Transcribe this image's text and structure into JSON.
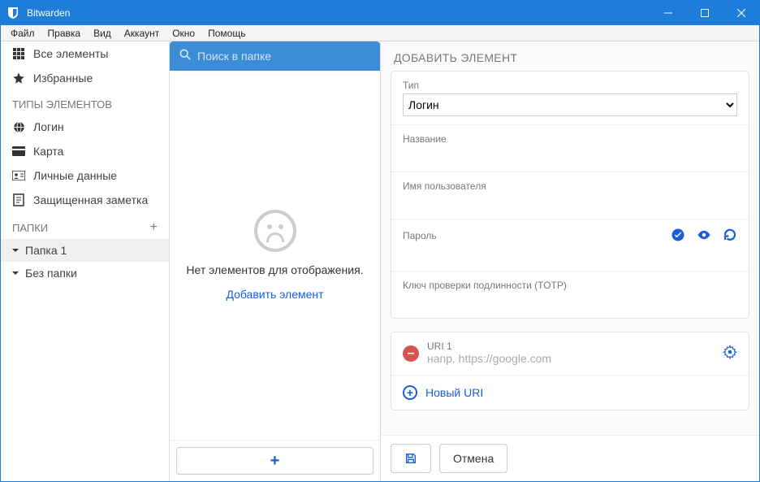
{
  "window": {
    "title": "Bitwarden"
  },
  "menus": {
    "file": "Файл",
    "edit": "Правка",
    "view": "Вид",
    "account": "Аккаунт",
    "window": "Окно",
    "help": "Помощь"
  },
  "sidebar": {
    "all_items": "Все элементы",
    "favorites": "Избранные",
    "types_header": "ТИПЫ ЭЛЕМЕНТОВ",
    "login": "Логин",
    "card": "Карта",
    "identity": "Личные данные",
    "secure_note": "Защищенная заметка",
    "folders_header": "ПАПКИ",
    "folder1": "Папка 1",
    "no_folder": "Без папки"
  },
  "search": {
    "placeholder": "Поиск в папке"
  },
  "middle": {
    "no_items": "Нет элементов для отображения.",
    "add_item": "Добавить элемент"
  },
  "form": {
    "header": "ДОБАВИТЬ ЭЛЕМЕНТ",
    "type_label": "Тип",
    "type_value": "Логин",
    "name_label": "Название",
    "username_label": "Имя пользователя",
    "password_label": "Пароль",
    "totp_label": "Ключ проверки подлинности (TOTP)",
    "uri1_label": "URI 1",
    "uri1_placeholder": "напр. https://google.com",
    "new_uri": "Новый URI",
    "cancel": "Отмена"
  }
}
